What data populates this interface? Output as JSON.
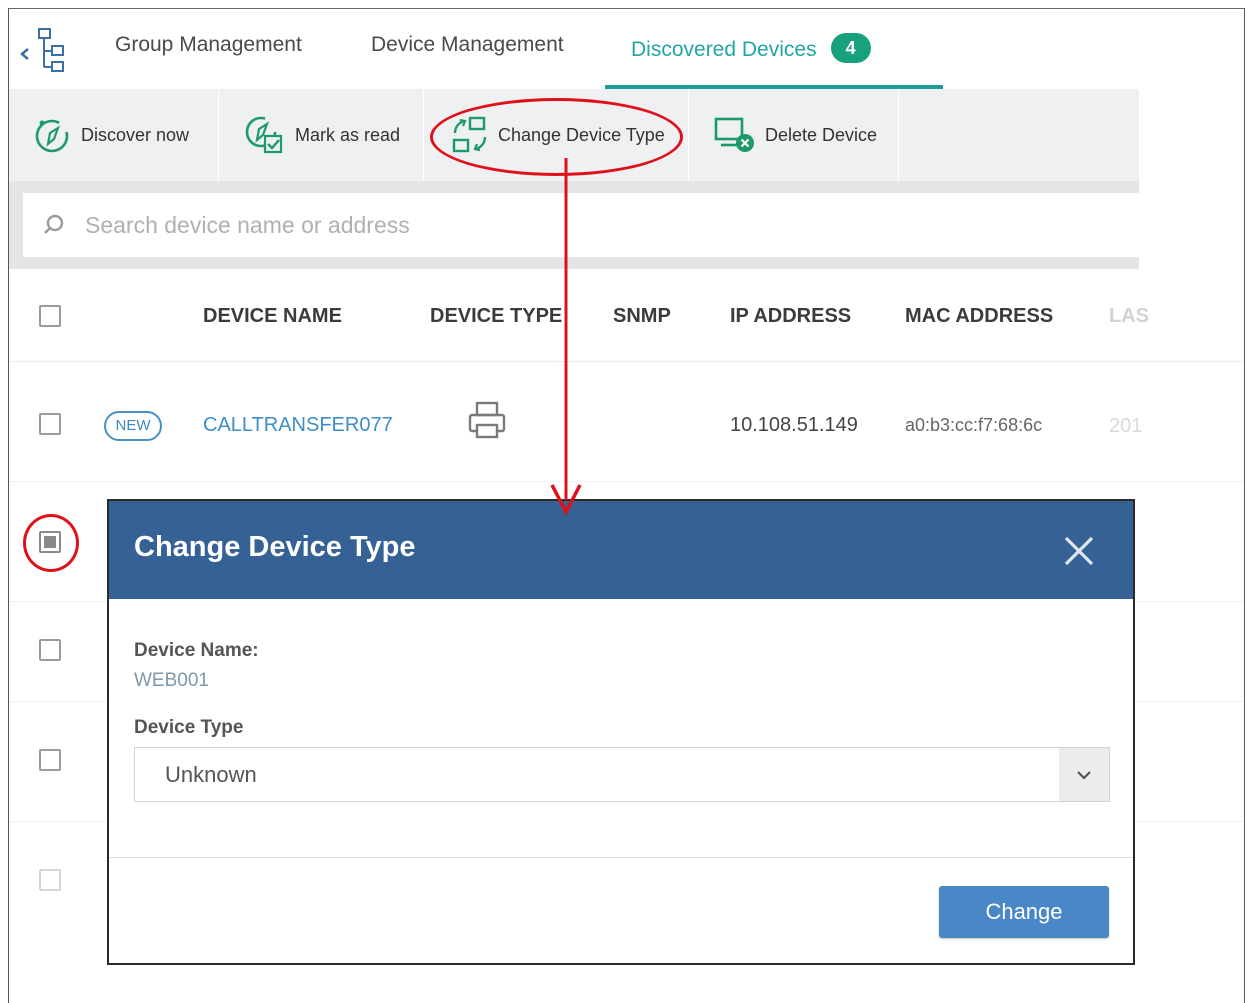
{
  "tabs": [
    {
      "label": "Group Management"
    },
    {
      "label": "Device Management"
    },
    {
      "label": "Discovered Devices",
      "badge": "4",
      "active": true
    }
  ],
  "toolbar": {
    "discover_label": "Discover now",
    "mark_read_label": "Mark as read",
    "change_type_label": "Change Device Type",
    "delete_label": "Delete Device"
  },
  "search": {
    "placeholder": "Search device name or address"
  },
  "table": {
    "columns": {
      "name": "DEVICE NAME",
      "type": "DEVICE TYPE",
      "snmp": "SNMP",
      "ip": "IP ADDRESS",
      "mac": "MAC ADDRESS",
      "last": "LAS"
    },
    "rows": [
      {
        "badge": "NEW",
        "name": "CALLTRANSFER077",
        "type_icon": "printer-icon",
        "ip": "10.108.51.149",
        "mac": "a0:b3:cc:f7:68:6c",
        "last": "201"
      }
    ]
  },
  "modal": {
    "title": "Change Device Type",
    "device_name_label": "Device Name:",
    "device_name_value": "WEB001",
    "device_type_label": "Device Type",
    "device_type_value": "Unknown",
    "submit_label": "Change"
  },
  "colors": {
    "accent_teal": "#24a4a4",
    "badge_green": "#19a07c",
    "modal_header": "#356195",
    "primary_button": "#4a87c7",
    "annotation_red": "#e0101a",
    "link_blue": "#3e8ec7"
  }
}
